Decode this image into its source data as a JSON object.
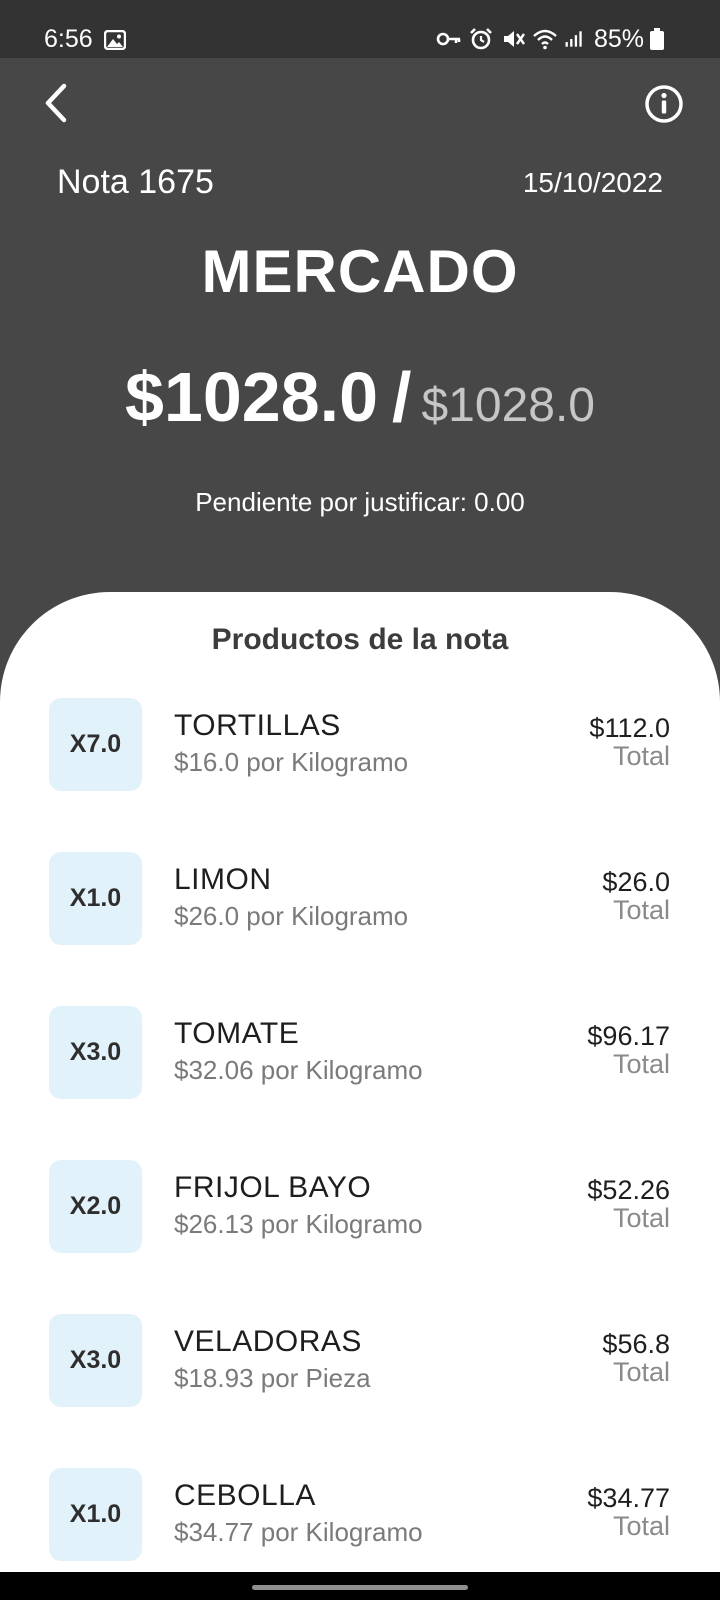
{
  "status_bar": {
    "time": "6:56",
    "battery": "85%",
    "icons": [
      "image-icon",
      "key-icon",
      "alarm-icon",
      "mute-icon",
      "wifi-icon",
      "signal-icon",
      "battery-icon"
    ]
  },
  "header": {
    "back_icon": "chevron-left-icon",
    "info_icon": "info-icon",
    "note_number": "Nota 1675",
    "date": "15/10/2022",
    "category": "MERCADO",
    "amount_spent": "$1028.0",
    "amount_separator": "/",
    "amount_total": "$1028.0",
    "pending_text": "Pendiente por justificar: 0.00"
  },
  "products_section": {
    "title": "Productos de la nota",
    "total_label": "Total",
    "items": [
      {
        "qty": "X7.0",
        "name": "TORTILLAS",
        "unit_price": "$16.0 por Kilogramo",
        "total": "$112.0"
      },
      {
        "qty": "X1.0",
        "name": "LIMON",
        "unit_price": "$26.0 por Kilogramo",
        "total": "$26.0"
      },
      {
        "qty": "X3.0",
        "name": "TOMATE",
        "unit_price": "$32.06 por Kilogramo",
        "total": "$96.17"
      },
      {
        "qty": "X2.0",
        "name": "FRIJOL BAYO",
        "unit_price": "$26.13 por Kilogramo",
        "total": "$52.26"
      },
      {
        "qty": "X3.0",
        "name": "VELADORAS",
        "unit_price": "$18.93 por Pieza",
        "total": "$56.8"
      },
      {
        "qty": "X1.0",
        "name": "CEBOLLA",
        "unit_price": "$34.77 por Kilogramo",
        "total": "$34.77"
      }
    ]
  },
  "colors": {
    "header_bg": "#474747",
    "status_bar_bg": "#333333",
    "sheet_bg": "#ffffff",
    "qty_badge_bg": "#e2f2fb",
    "secondary_text": "#7a7a7a"
  }
}
